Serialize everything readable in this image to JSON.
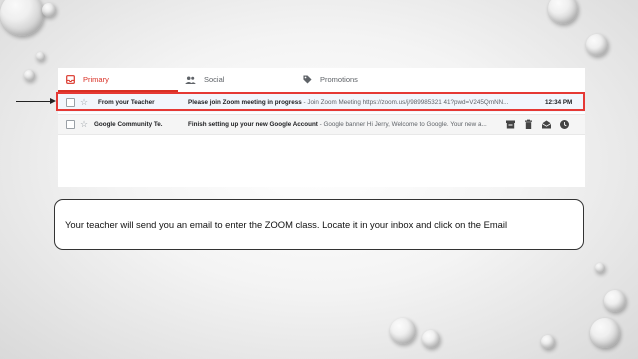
{
  "tabs": [
    {
      "label": "Primary",
      "icon": "inbox-icon",
      "active": true
    },
    {
      "label": "Social",
      "icon": "people-icon",
      "active": false
    },
    {
      "label": "Promotions",
      "icon": "tag-icon",
      "active": false
    }
  ],
  "emails": [
    {
      "sender": "From your Teacher",
      "subject": "Please join Zoom meeting in progress",
      "snippet": " - Join Zoom Meeting https://zoom.us/j/989985321 41?pwd=V245QmNN...",
      "time": "12:34 PM",
      "highlighted": true
    },
    {
      "sender": "Google Community Te.",
      "subject": "Finish setting up your new Google Account",
      "snippet": " - Google banner Hi Jerry, Welcome to Google. Your new a...",
      "hover_actions": [
        "archive-icon",
        "delete-icon",
        "mark-read-icon",
        "snooze-icon"
      ]
    }
  ],
  "caption": "Your teacher will send you an email to enter the ZOOM class. Locate it in your inbox and click on the Email",
  "colors": {
    "accent_red": "#d93025",
    "highlight_border": "#e53935"
  }
}
